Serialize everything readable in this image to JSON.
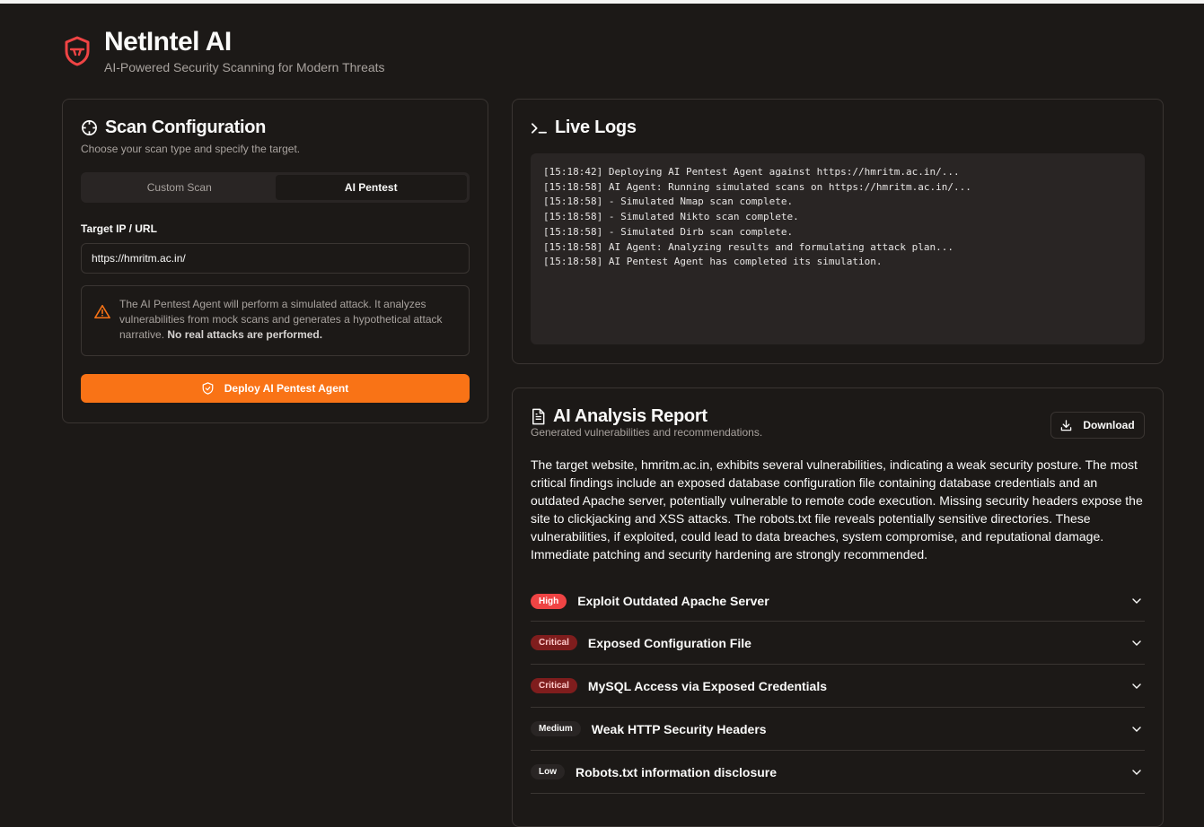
{
  "app": {
    "title": "NetIntel AI",
    "subtitle": "AI-Powered Security Scanning for Modern Threats",
    "brand_color": "#ef4444"
  },
  "config": {
    "title": "Scan Configuration",
    "description": "Choose your scan type and specify the target.",
    "tabs": [
      {
        "label": "Custom Scan",
        "active": false
      },
      {
        "label": "AI Pentest",
        "active": true
      }
    ],
    "target_label": "Target IP / URL",
    "target_value": "https://hmritm.ac.in/",
    "notice_text": "The AI Pentest Agent will perform a simulated attack. It analyzes vulnerabilities from mock scans and generates a hypothetical attack narrative. ",
    "notice_bold": "No real attacks are performed.",
    "deploy_label": "Deploy AI Pentest Agent",
    "accent_color": "#f97316"
  },
  "logs": {
    "title": "Live Logs",
    "lines": [
      "[15:18:42] Deploying AI Pentest Agent against https://hmritm.ac.in/...",
      "[15:18:58] AI Agent: Running simulated scans on https://hmritm.ac.in/...",
      "[15:18:58] - Simulated Nmap scan complete.",
      "[15:18:58] - Simulated Nikto scan complete.",
      "[15:18:58] - Simulated Dirb scan complete.",
      "[15:18:58] AI Agent: Analyzing results and formulating attack plan...",
      "[15:18:58] AI Pentest Agent has completed its simulation."
    ]
  },
  "report": {
    "title": "AI Analysis Report",
    "description": "Generated vulnerabilities and recommendations.",
    "download_label": "Download",
    "summary": "The target website, hmritm.ac.in, exhibits several vulnerabilities, indicating a weak security posture. The most critical findings include an exposed database configuration file containing database credentials and an outdated Apache server, potentially vulnerable to remote code execution. Missing security headers expose the site to clickjacking and XSS attacks. The robots.txt file reveals potentially sensitive directories. These vulnerabilities, if exploited, could lead to data breaches, system compromise, and reputational damage. Immediate patching and security hardening are strongly recommended.",
    "findings": [
      {
        "severity": "High",
        "title": "Exploit Outdated Apache Server",
        "bg": "#ef4444",
        "fg": "#ffffff"
      },
      {
        "severity": "Critical",
        "title": "Exposed Configuration File",
        "bg": "#7f1d1d",
        "fg": "#fecaca"
      },
      {
        "severity": "Critical",
        "title": "MySQL Access via Exposed Credentials",
        "bg": "#7f1d1d",
        "fg": "#fecaca"
      },
      {
        "severity": "Medium",
        "title": "Weak HTTP Security Headers",
        "bg": "#292524",
        "fg": "#fafaf9"
      },
      {
        "severity": "Low",
        "title": "Robots.txt information disclosure",
        "bg": "#292524",
        "fg": "#fafaf9"
      }
    ]
  }
}
